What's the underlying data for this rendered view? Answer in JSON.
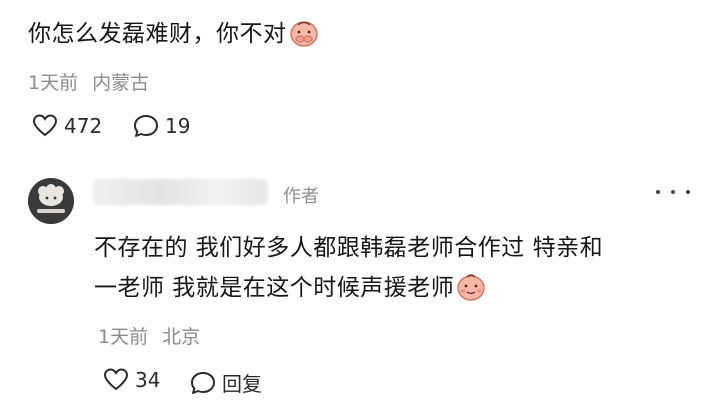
{
  "comment": {
    "text": "你怎么发磊难财，你不对",
    "time": "1天前",
    "location": "内蒙古",
    "likes": "472",
    "replies": "19"
  },
  "reply": {
    "author_tag": "作者",
    "line1": "不存在的 我们好多人都跟韩磊老师合作过 特亲和",
    "line2": "一老师 我就是在这个时候声援老师",
    "time": "1天前",
    "location": "北京",
    "likes": "34",
    "reply_label": "回复"
  },
  "colors": {
    "text": "#161616",
    "meta": "#8b8b8b",
    "emoji": "#f6b7a6"
  }
}
